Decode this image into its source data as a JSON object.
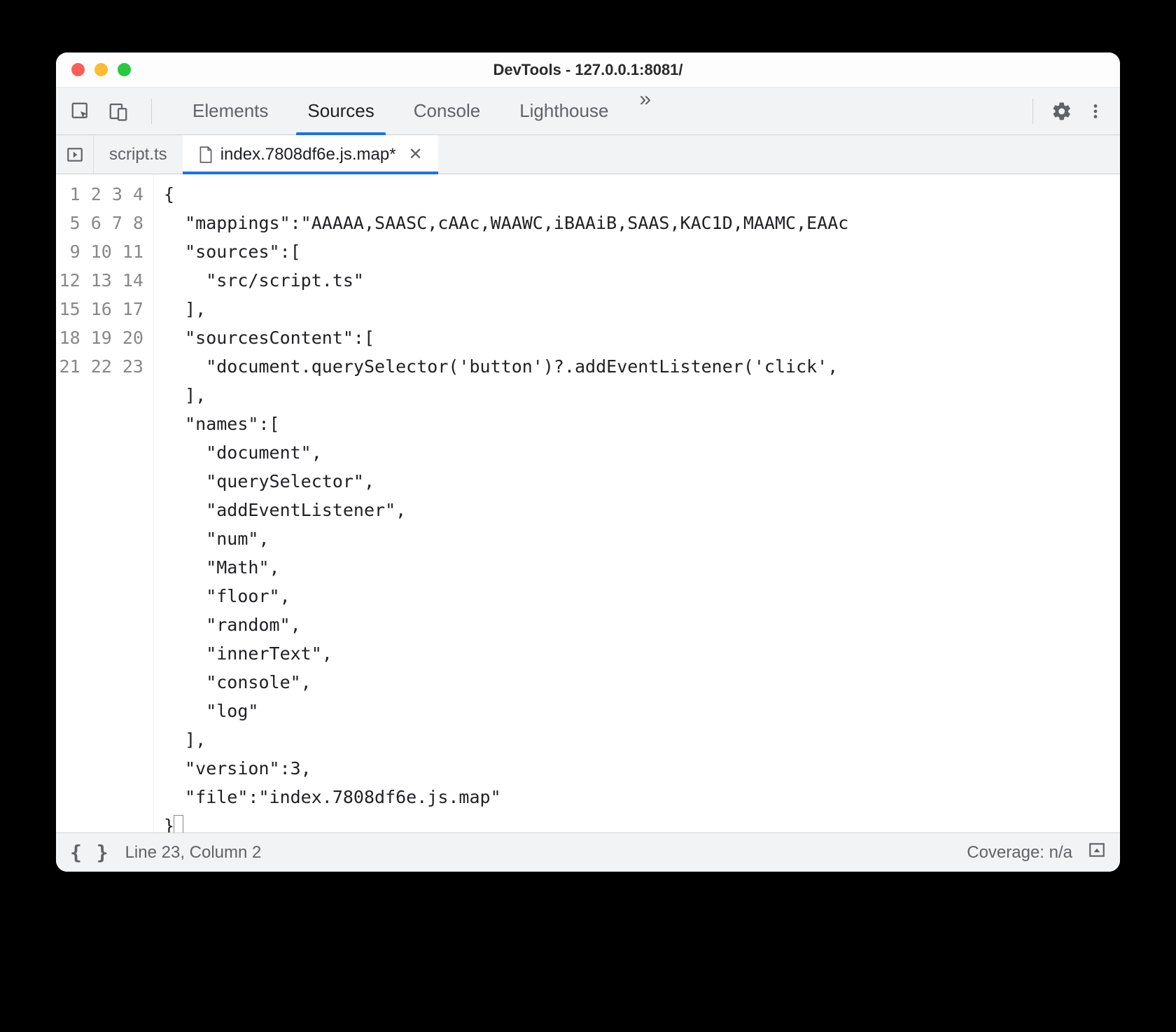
{
  "window": {
    "title": "DevTools - 127.0.0.1:8081/"
  },
  "toolbar": {
    "tabs": [
      "Elements",
      "Sources",
      "Console",
      "Lighthouse"
    ],
    "active_tab_index": 1,
    "more_glyph": "»"
  },
  "file_tabs": {
    "items": [
      {
        "label": "script.ts",
        "active": false,
        "modified": false
      },
      {
        "label": "index.7808df6e.js.map*",
        "active": true,
        "modified": true
      }
    ]
  },
  "editor": {
    "line_count": 23,
    "lines": [
      "{",
      "  \"mappings\":\"AAAAA,SAASC,cAAc,WAAWC,iBAAiB,SAAS,KAC1D,MAAMC,EAAc",
      "  \"sources\":[",
      "    \"src/script.ts\"",
      "  ],",
      "  \"sourcesContent\":[",
      "    \"document.querySelector('button')?.addEventListener('click',",
      "  ],",
      "  \"names\":[",
      "    \"document\",",
      "    \"querySelector\",",
      "    \"addEventListener\",",
      "    \"num\",",
      "    \"Math\",",
      "    \"floor\",",
      "    \"random\",",
      "    \"innerText\",",
      "    \"console\",",
      "    \"log\"",
      "  ],",
      "  \"version\":3,",
      "  \"file\":\"index.7808df6e.js.map\"",
      "}"
    ]
  },
  "statusbar": {
    "position": "Line 23, Column 2",
    "coverage": "Coverage: n/a"
  }
}
